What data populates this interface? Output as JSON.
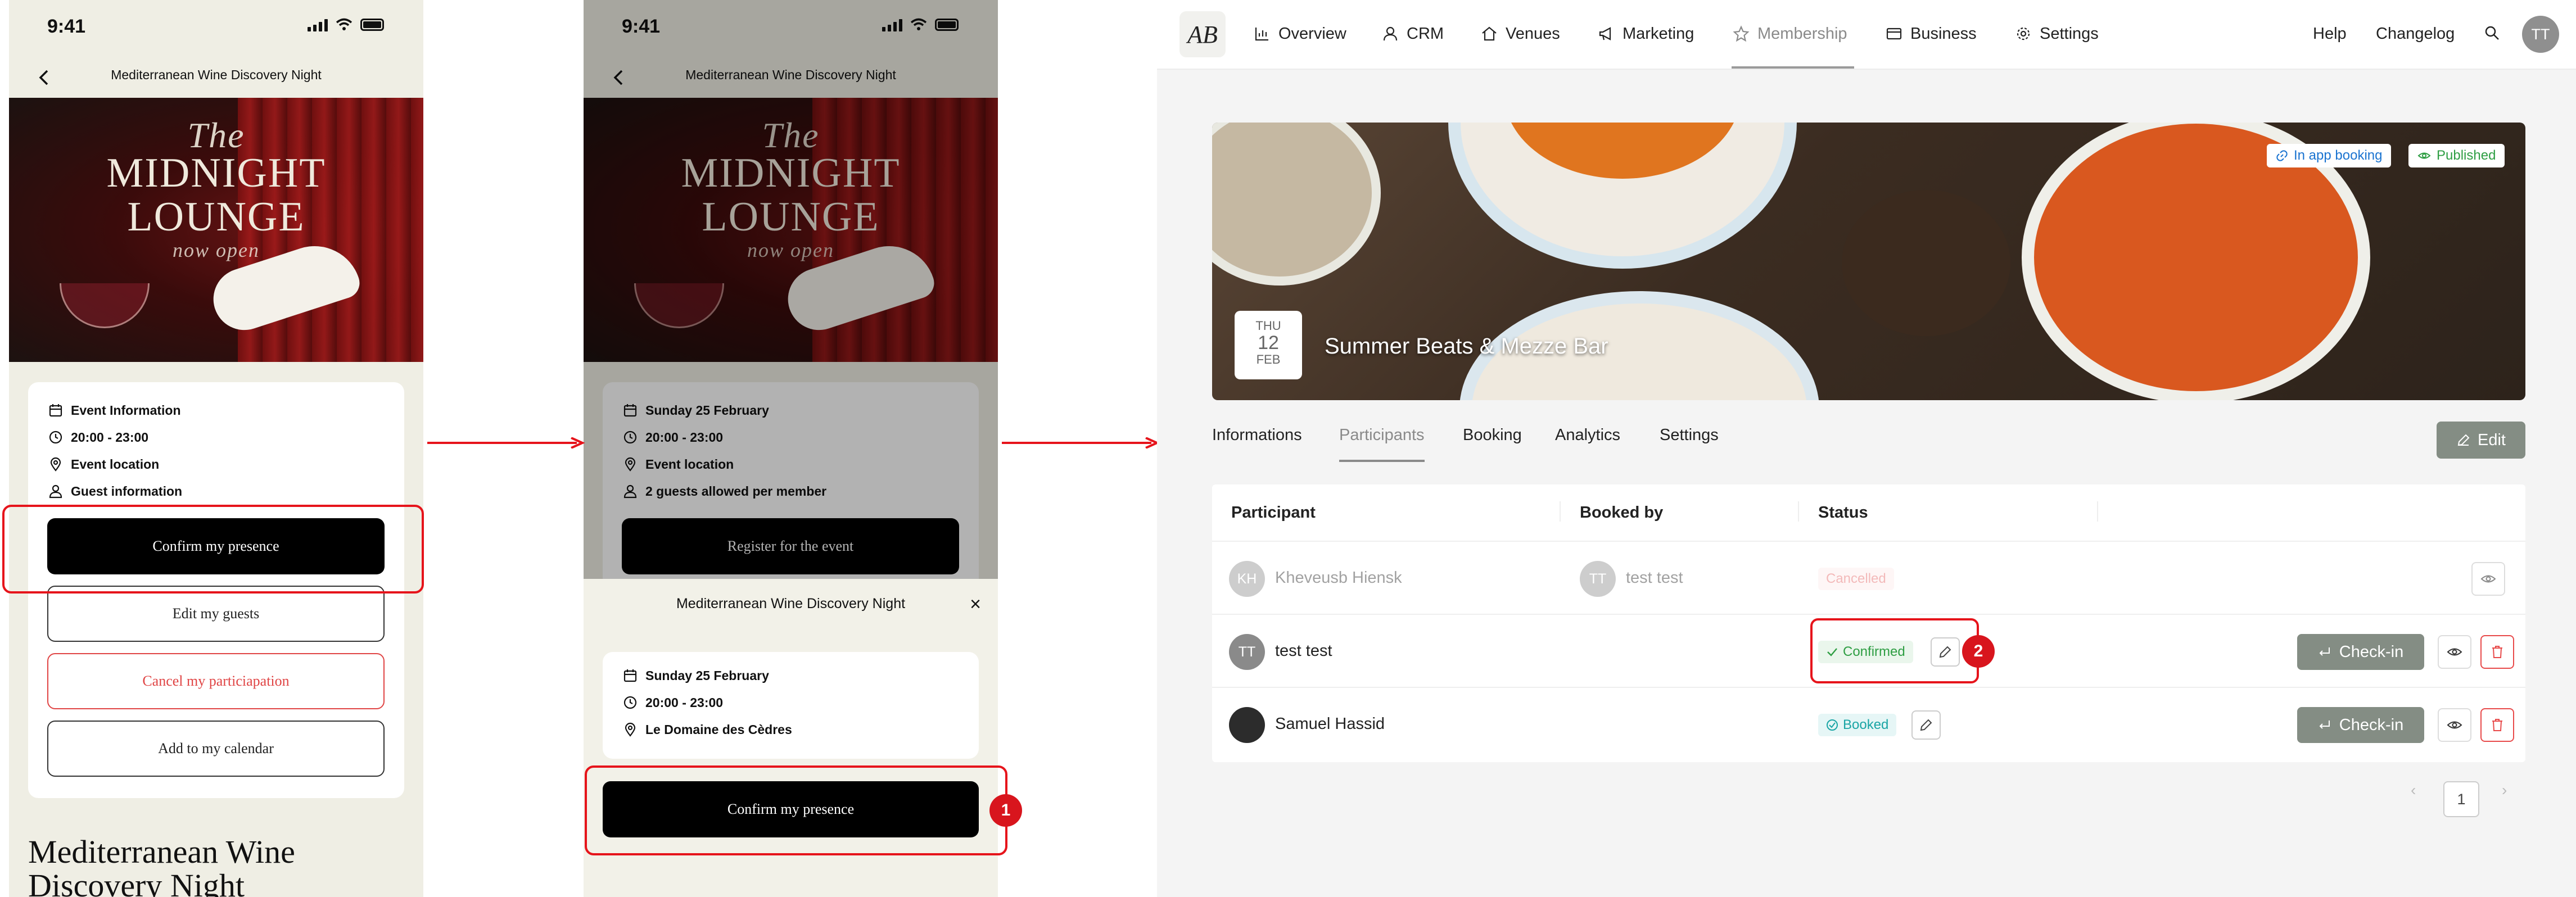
{
  "phone1": {
    "status_time": "9:41",
    "nav_title": "Mediterranean Wine Discovery Night",
    "hero": {
      "line1": "The",
      "line2": "MIDNIGHT",
      "line3": "LOUNGE",
      "line4": "now open"
    },
    "info": [
      "Event Information",
      "20:00 - 23:00",
      "Event location",
      "Guest information"
    ],
    "buttons": {
      "confirm": "Confirm my presence",
      "edit_guests": "Edit my guests",
      "cancel": "Cancel my particiapation",
      "calendar": "Add to my calendar"
    },
    "big_title": "Mediterranean Wine Discovery Night"
  },
  "phone2": {
    "status_time": "9:41",
    "nav_title": "Mediterranean Wine Discovery Night",
    "hero": {
      "line1": "The",
      "line2": "MIDNIGHT",
      "line3": "LOUNGE",
      "line4": "now open"
    },
    "info": [
      "Sunday 25 February",
      "20:00 - 23:00",
      "Event location",
      "2 guests allowed per member"
    ],
    "register_button": "Register for the event",
    "sheet": {
      "title": "Mediterranean Wine Discovery Night",
      "close": "×",
      "info": [
        "Sunday 25 February",
        "20:00 - 23:00",
        "Le Domaine des Cèdres"
      ],
      "confirm": "Confirm my presence"
    },
    "step_badge": "1"
  },
  "web": {
    "logo": "AB",
    "nav": [
      "Overview",
      "CRM",
      "Venues",
      "Marketing",
      "Membership",
      "Business",
      "Settings"
    ],
    "active_nav": "Membership",
    "right_nav": {
      "help": "Help",
      "changelog": "Changelog",
      "avatar": "TT"
    },
    "banner": {
      "tags": {
        "in_app": "In app booking",
        "published": "Published"
      },
      "date": {
        "dow": "THU",
        "day": "12",
        "month": "FEB"
      },
      "title": "Summer Beats & Mezze Bar"
    },
    "tabs": [
      "Informations",
      "Participants",
      "Booking",
      "Analytics",
      "Settings"
    ],
    "active_tab": "Participants",
    "edit_label": "Edit",
    "table": {
      "headers": [
        "Participant",
        "Booked by",
        "Status"
      ],
      "rows": [
        {
          "initials": "KH",
          "name": "Kheveusb Hiensk",
          "booked_by_initials": "TT",
          "booked_by": "test test",
          "status": "Cancelled"
        },
        {
          "initials": "TT",
          "name": "test test",
          "status": "Confirmed",
          "action": "Check-in"
        },
        {
          "initials": "",
          "name": "Samuel Hassid",
          "status": "Booked",
          "action": "Check-in"
        }
      ]
    },
    "step_badge": "2",
    "pagination": {
      "prev": "‹",
      "page": "1",
      "next": "›"
    }
  },
  "colors": {
    "accent_red": "#e6141b",
    "confirmed_green": "#2e9e43",
    "booked_teal": "#1aa5a5",
    "cancelled_red": "#e35a5a",
    "check_in_gray": "#848d84"
  }
}
